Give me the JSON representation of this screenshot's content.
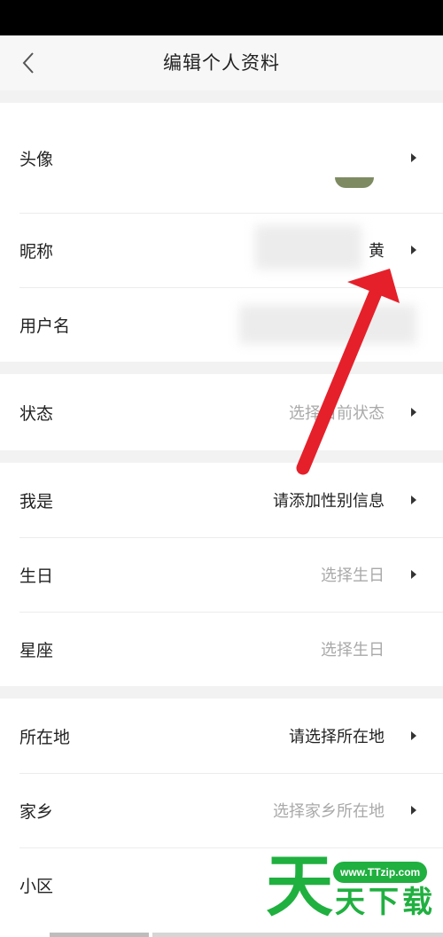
{
  "header": {
    "title": "编辑个人资料",
    "back_icon": "chevron-left-icon"
  },
  "profile": {
    "avatar_label": "头像",
    "nickname_label": "昵称",
    "nickname_value": "黄",
    "username_label": "用户名"
  },
  "status": {
    "label": "状态",
    "placeholder": "选择目前状态"
  },
  "personal": {
    "gender_label": "我是",
    "gender_value": "请添加性别信息",
    "birthday_label": "生日",
    "birthday_placeholder": "选择生日",
    "zodiac_label": "星座",
    "zodiac_placeholder": "选择生日"
  },
  "location": {
    "location_label": "所在地",
    "location_value": "请选择所在地",
    "hometown_label": "家乡",
    "hometown_placeholder": "选择家乡所在地",
    "community_label": "小区"
  },
  "watermark": {
    "char": "天",
    "url": "www.TTzip.com",
    "text": "天下载"
  },
  "colors": {
    "annotation_arrow": "#e5202a",
    "watermark_green": "#20b040",
    "placeholder_text": "#a9a9a9"
  }
}
